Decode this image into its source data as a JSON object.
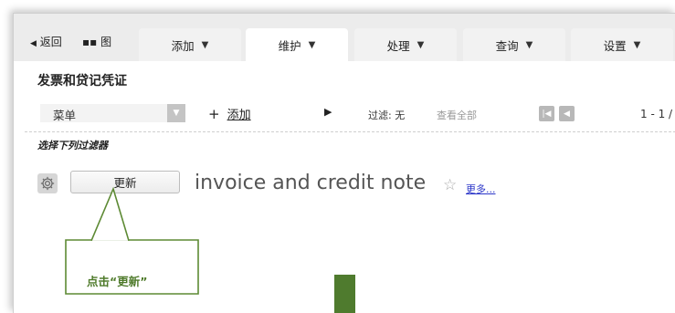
{
  "nav": {
    "back_label": "返回",
    "chart_label": "图"
  },
  "tabs": [
    {
      "label": "添加"
    },
    {
      "label": "维护"
    },
    {
      "label": "处理"
    },
    {
      "label": "查询"
    },
    {
      "label": "设置"
    }
  ],
  "page": {
    "title": "发票和贷记凭证"
  },
  "toolbar": {
    "menu_value": "菜单",
    "add_label": "添加",
    "filter_label": "过滤: 无",
    "show_all_label": "查看全部",
    "page_range": "1 - 1 /"
  },
  "filters": {
    "hint": "选择下列过滤器",
    "update_button_label": "更新",
    "report_name": "invoice and credit note",
    "more_label": "更多..."
  },
  "callout": {
    "text": "点击“更新”",
    "color": "#5d8a34"
  },
  "icons": {
    "back": "triangle-left",
    "chart": "grid-squares",
    "settings": "gear",
    "favorite": "star-outline",
    "pager_first": "skip-first",
    "pager_prev": "triangle-left",
    "play": "triangle-right"
  },
  "colors": {
    "accent_green": "#4f7b2e",
    "link_blue": "#2a35c8"
  }
}
